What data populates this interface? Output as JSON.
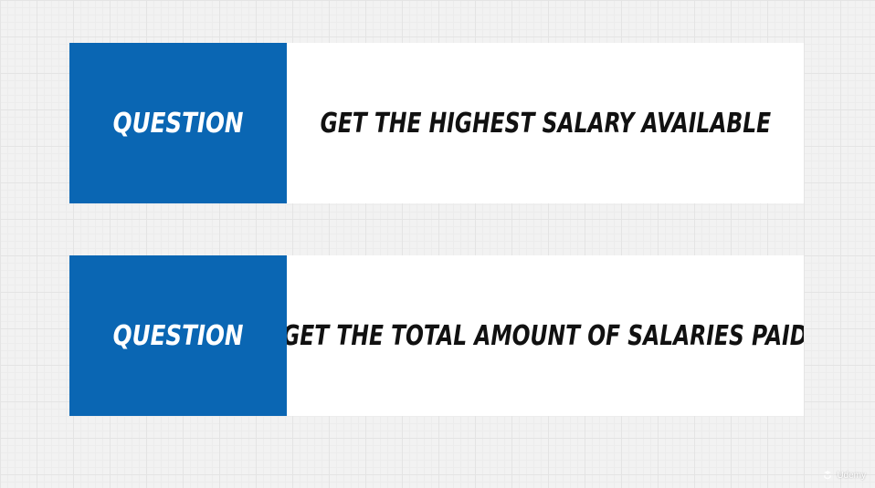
{
  "cards": [
    {
      "label": "QUESTION",
      "question": "GET THE HIGHEST SALARY AVAILABLE"
    },
    {
      "label": "QUESTION",
      "question": "GET THE TOTAL AMOUNT OF SALARIES PAID"
    }
  ],
  "watermark": {
    "icon": "udemy-logo-icon",
    "text": "Udemy"
  },
  "colors": {
    "label_bg": "#0a66b3",
    "label_text": "#ffffff",
    "question_text": "#111111",
    "card_bg": "#ffffff"
  }
}
